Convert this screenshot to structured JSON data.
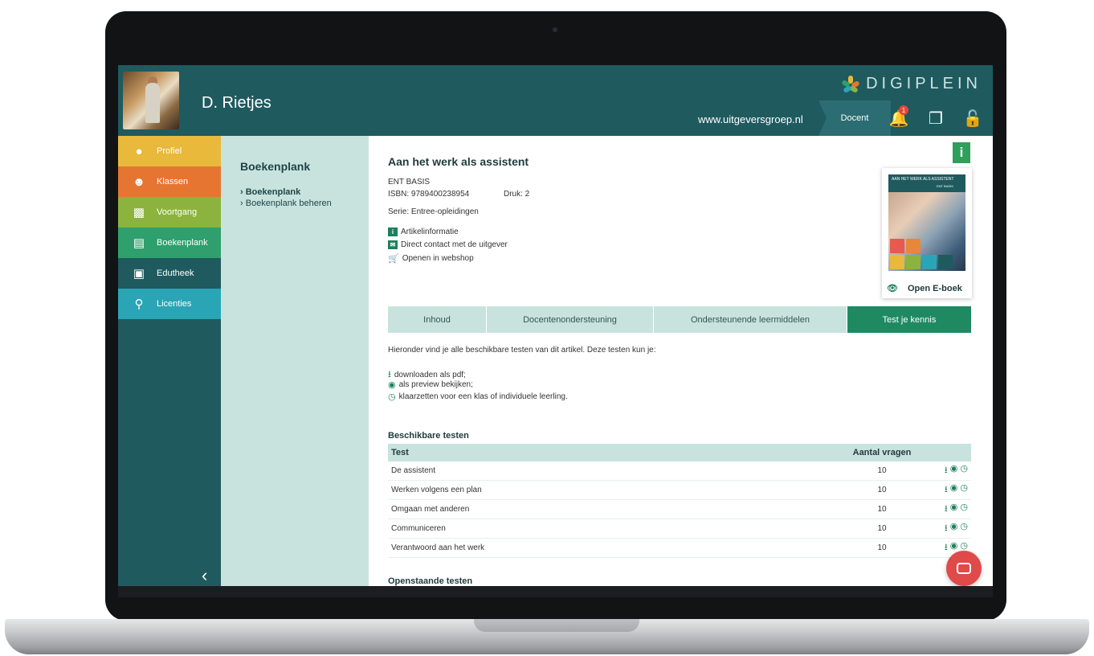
{
  "user": {
    "name": "D. Rietjes"
  },
  "brand": {
    "name": "DIGIPLEIN"
  },
  "header": {
    "site_url": "www.uitgeversgroep.nl",
    "role": "Docent",
    "notification_count": "1"
  },
  "sidebar": {
    "items": [
      {
        "label": "Profiel",
        "color": "#e8b93a",
        "icon": "person-icon"
      },
      {
        "label": "Klassen",
        "color": "#e67532",
        "icon": "group-icon"
      },
      {
        "label": "Voortgang",
        "color": "#8cb33e",
        "icon": "chart-icon"
      },
      {
        "label": "Boekenplank",
        "color": "#2f9f6d",
        "icon": "book-icon",
        "active": true
      },
      {
        "label": "Edutheek",
        "color": "#1f5a5f",
        "icon": "puzzle-icon"
      },
      {
        "label": "Licenties",
        "color": "#2aa5b5",
        "icon": "key-icon"
      }
    ],
    "collapse_label": "‹"
  },
  "subnav": {
    "title": "Boekenplank",
    "items": [
      {
        "label": "Boekenplank",
        "bold": true
      },
      {
        "label": "Boekenplank beheren",
        "bold": false
      }
    ]
  },
  "book": {
    "title": "Aan het werk als assistent",
    "level": "ENT BASIS",
    "isbn": "ISBN: 9789400238954",
    "edition": "Druk: 2",
    "series": "Serie: Entree-opleidingen",
    "links": [
      "Artikelinformatie",
      "Direct contact met de uitgever",
      "Openen in webshop"
    ],
    "cover_title": "AAN HET WERK ALS ASSISTENT",
    "cover_sub": "ENT BASIS",
    "open_ebook": "Open E-boek"
  },
  "tabs": [
    {
      "label": "Inhoud",
      "active": false
    },
    {
      "label": "Docentenondersteuning",
      "active": false
    },
    {
      "label": "Ondersteunende leermiddelen",
      "active": false
    },
    {
      "label": "Test je kennis",
      "active": true
    }
  ],
  "intro": "Hieronder vind je alle beschikbare testen van dit artikel. Deze testen kun je:",
  "options": [
    "downloaden als pdf;",
    "als preview bekijken;",
    "klaarzetten voor een klas of individuele leerling."
  ],
  "available_tests": {
    "title": "Beschikbare testen",
    "col_test": "Test",
    "col_count": "Aantal vragen",
    "rows": [
      {
        "test": "De assistent",
        "count": "10"
      },
      {
        "test": "Werken volgens een plan",
        "count": "10"
      },
      {
        "test": "Omgaan met anderen",
        "count": "10"
      },
      {
        "test": "Communiceren",
        "count": "10"
      },
      {
        "test": "Verantwoord aan het werk",
        "count": "10"
      }
    ]
  },
  "open_tests": {
    "title": "Openstaande testen"
  }
}
